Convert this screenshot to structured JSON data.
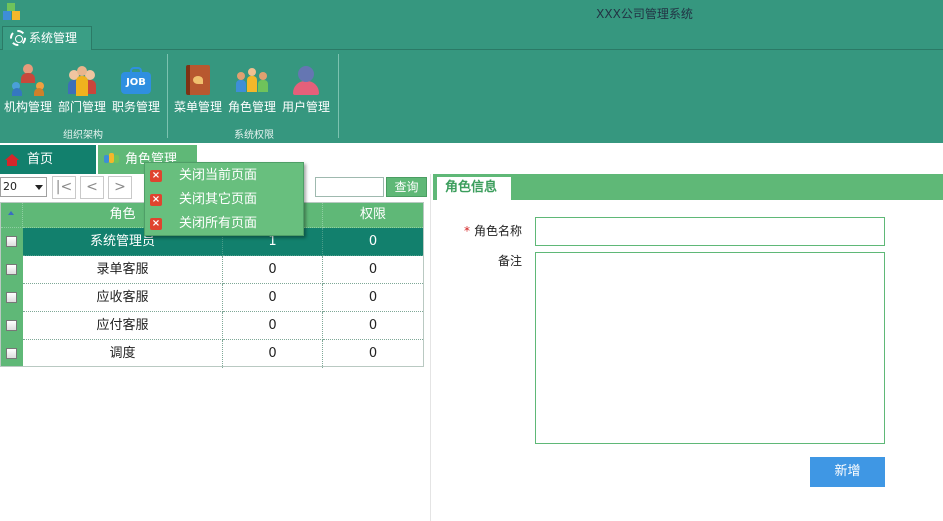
{
  "window": {
    "title": "XXX公司管理系统"
  },
  "ribbon": {
    "tab": "系统管理",
    "groups": [
      {
        "label": "组织架构",
        "buttons": [
          "机构管理",
          "部门管理",
          "职务管理"
        ]
      },
      {
        "label": "系统权限",
        "buttons": [
          "菜单管理",
          "角色管理",
          "用户管理"
        ]
      }
    ],
    "job_icon_text": "JOB"
  },
  "page_tabs": {
    "home": "首页",
    "role": "角色管理"
  },
  "context_menu": [
    "关闭当前页面",
    "关闭其它页面",
    "关闭所有页面"
  ],
  "toolbar": {
    "page_size": "20",
    "pager": {
      "first": "|<",
      "prev": "<",
      "next": ">"
    },
    "search_value": "",
    "query": "查询"
  },
  "grid": {
    "columns": [
      "角色",
      "",
      "权限"
    ],
    "rows": [
      [
        "系统管理员",
        "1",
        "0"
      ],
      [
        "录单客服",
        "0",
        "0"
      ],
      [
        "应收客服",
        "0",
        "0"
      ],
      [
        "应付客服",
        "0",
        "0"
      ],
      [
        "调度",
        "0",
        "0"
      ]
    ]
  },
  "form": {
    "tab": "角色信息",
    "required_mark": "*",
    "name_label": "角色名称",
    "remark_label": "备注",
    "name_value": "",
    "remark_value": "",
    "submit": "新增"
  },
  "colors": {
    "primary": "#36977f",
    "accent": "#5fb877",
    "selected": "#12806d",
    "button_blue": "#3f97e4"
  }
}
